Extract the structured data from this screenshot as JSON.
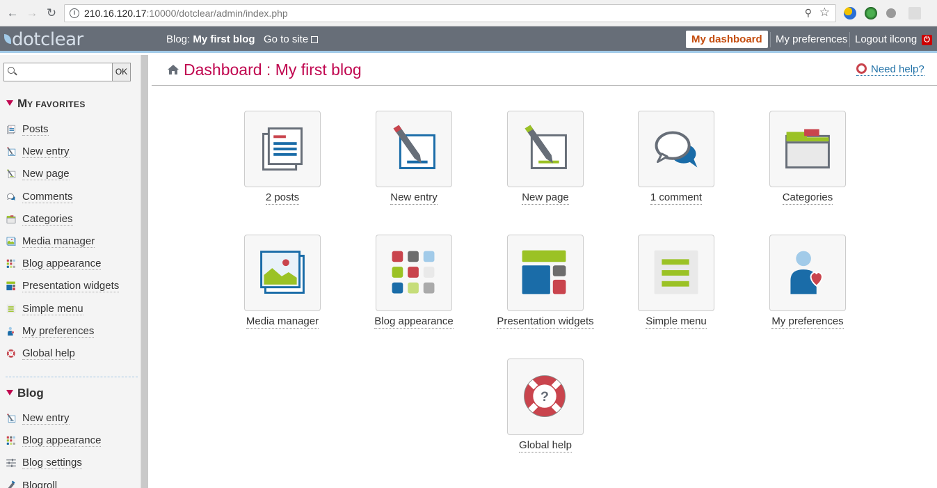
{
  "browser": {
    "url_host": "210.16.120.17",
    "url_rest": ":10000/dotclear/admin/index.php"
  },
  "header": {
    "logo_text": "dotclear",
    "blog_prefix": "Blog: ",
    "blog_name": "My first blog",
    "go_to_site": "Go to site",
    "my_dashboard": "My dashboard",
    "my_preferences": "My preferences",
    "logout": "Logout ilcong"
  },
  "sidebar": {
    "search_button": "OK",
    "favorites_title_big": "M",
    "favorites_title_small": "Y FAVORITES",
    "favorites": [
      {
        "label": "Posts",
        "icon": "posts-icon"
      },
      {
        "label": "New entry",
        "icon": "new-entry-icon"
      },
      {
        "label": "New page",
        "icon": "new-page-icon"
      },
      {
        "label": "Comments",
        "icon": "comments-icon"
      },
      {
        "label": "Categories",
        "icon": "categories-icon"
      },
      {
        "label": "Media manager",
        "icon": "media-icon"
      },
      {
        "label": "Blog appearance",
        "icon": "appearance-icon"
      },
      {
        "label": "Presentation widgets",
        "icon": "widgets-icon"
      },
      {
        "label": "Simple menu",
        "icon": "simple-menu-icon"
      },
      {
        "label": "My preferences",
        "icon": "user-prefs-icon"
      },
      {
        "label": "Global help",
        "icon": "help-buoy-icon"
      }
    ],
    "blog_title": "Blog",
    "blog_items": [
      {
        "label": "New entry",
        "icon": "new-entry-icon"
      },
      {
        "label": "Blog appearance",
        "icon": "appearance-icon"
      },
      {
        "label": "Blog settings",
        "icon": "settings-sliders-icon"
      },
      {
        "label": "Blogroll",
        "icon": "blogroll-icon"
      }
    ]
  },
  "main": {
    "title": "Dashboard : My first blog",
    "need_help": "Need help?",
    "tiles": [
      {
        "label": "2 posts",
        "icon": "posts-icon"
      },
      {
        "label": "New entry",
        "icon": "new-entry-icon"
      },
      {
        "label": "New page",
        "icon": "new-page-icon"
      },
      {
        "label": "1 comment",
        "icon": "comments-icon"
      },
      {
        "label": "Categories",
        "icon": "categories-icon"
      },
      {
        "label": "Media manager",
        "icon": "media-icon"
      },
      {
        "label": "Blog appearance",
        "icon": "appearance-icon"
      },
      {
        "label": "Presentation widgets",
        "icon": "widgets-icon"
      },
      {
        "label": "Simple menu",
        "icon": "simple-menu-icon"
      },
      {
        "label": "My preferences",
        "icon": "user-prefs-icon"
      },
      {
        "label": "Global help",
        "icon": "help-buoy-icon"
      }
    ]
  },
  "colors": {
    "accent_red": "#c0064f",
    "header_bg": "#676e78",
    "link_blue": "#2373a8",
    "dashboard_orange": "#c44d0e"
  }
}
